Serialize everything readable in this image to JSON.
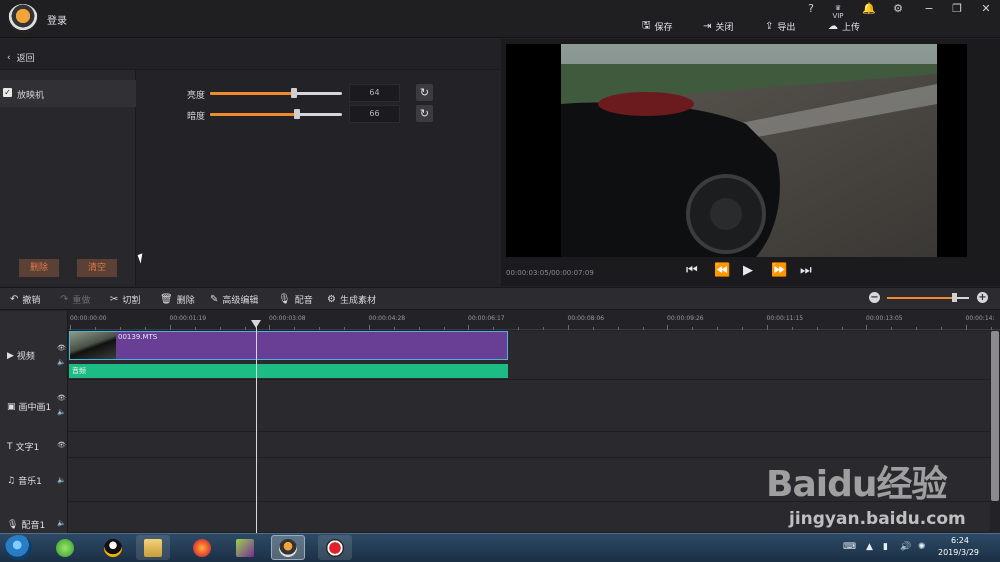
{
  "app": {
    "login_label": "登录"
  },
  "window_controls": [
    "?",
    "VIP",
    "bell",
    "gear",
    "minimize",
    "restore",
    "close"
  ],
  "top_actions": [
    {
      "label": "保存",
      "icon": "save-icon"
    },
    {
      "label": "关闭",
      "icon": "exit-icon"
    },
    {
      "label": "导出",
      "icon": "export-icon"
    },
    {
      "label": "上传",
      "icon": "upload-icon"
    }
  ],
  "left_panel": {
    "back_label": "返回",
    "effect": {
      "label": "放映机",
      "checked": true
    },
    "delete_label": "删除",
    "clear_label": "清空"
  },
  "adjust": {
    "brightness": {
      "label": "亮度",
      "value": "64",
      "fraction": 0.64
    },
    "darkness": {
      "label": "暗度",
      "value": "66",
      "fraction": 0.66
    }
  },
  "preview": {
    "timecode": "00:00:03:05/00:00:07:09"
  },
  "toolbar": {
    "undo": "撤销",
    "redo": "重做",
    "cut": "切割",
    "delete": "删除",
    "advanced": "高级编辑",
    "dub": "配音",
    "generate": "生成素材",
    "zoom_fraction": 0.83
  },
  "ruler_ticks": [
    "00:00:00:00",
    "00:00:01:19",
    "00:00:03:08",
    "00:00:04:28",
    "00:00:06:17",
    "00:00:08:06",
    "00:00:09:26",
    "00:00:11:15",
    "00:00:13:05",
    "00:00:14:"
  ],
  "tracks": {
    "video": "视频",
    "pip": "画中画1",
    "text": "文字1",
    "music": "音乐1",
    "voice": "配音1"
  },
  "clips": {
    "video_name": "00139.MTS",
    "audio_name": "音频"
  },
  "taskbar": {
    "time": "6:24",
    "date": "2019/3/29"
  },
  "watermark": {
    "brand": "Baidu经验",
    "url": "jingyan.baidu.com"
  },
  "colors": {
    "accent": "#f08a2c",
    "clip": "#693f96",
    "audio": "#1ebc85",
    "danger_text": "#e07a4c"
  }
}
